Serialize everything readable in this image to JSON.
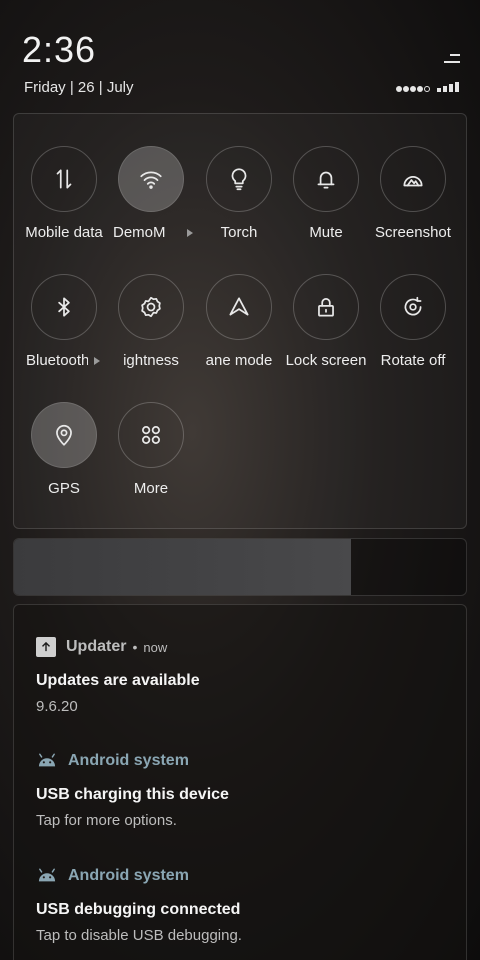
{
  "status": {
    "time": "2:36",
    "date": "Friday | 26 | July"
  },
  "quick_settings": {
    "tiles": [
      {
        "label": "Mobile data",
        "icon": "mobile-data-icon",
        "active": false
      },
      {
        "label": "DemoM",
        "icon": "wifi-icon",
        "active": true
      },
      {
        "label": "Torch",
        "icon": "torch-icon",
        "active": false
      },
      {
        "label": "Mute",
        "icon": "bell-icon",
        "active": false
      },
      {
        "label": "Screenshot",
        "icon": "screenshot-icon",
        "active": false
      },
      {
        "label": "Bluetooth",
        "icon": "bluetooth-icon",
        "active": false
      },
      {
        "label": "ightness",
        "icon": "brightness-gear-icon",
        "active": false
      },
      {
        "label": "ane mode",
        "icon": "plane-mode-icon",
        "active": false
      },
      {
        "label": "Lock screen",
        "icon": "lock-icon",
        "active": false
      },
      {
        "label": "Rotate off",
        "icon": "rotate-icon",
        "active": false
      },
      {
        "label": "GPS",
        "icon": "location-pin-icon",
        "active": true
      },
      {
        "label": "More",
        "icon": "grid-icon",
        "active": false
      }
    ]
  },
  "brightness": {
    "level": 0.745
  },
  "notifications": [
    {
      "app": "Updater",
      "time": "now",
      "icon": "update-arrow-icon",
      "title": "Updates are available",
      "text": "9.6.20"
    },
    {
      "app": "Android system",
      "icon": "android-icon",
      "title": "USB charging this device",
      "text": "Tap for more options."
    },
    {
      "app": "Android system",
      "icon": "android-icon",
      "title": "USB debugging connected",
      "text": "Tap to disable USB debugging."
    }
  ]
}
